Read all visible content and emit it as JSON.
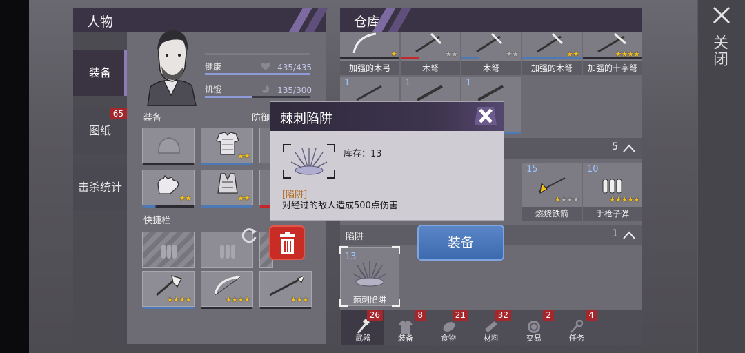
{
  "close": {
    "label": "关闭"
  },
  "character": {
    "title": "人物",
    "tabs": [
      {
        "label": "装备",
        "active": true,
        "badge": ""
      },
      {
        "label": "图纸",
        "active": false,
        "badge": "65"
      },
      {
        "label": "击杀统计",
        "active": false,
        "badge": ""
      }
    ],
    "stats": [
      {
        "label": "健康",
        "icon": "heart-icon",
        "value": "435/435",
        "fill": 1.0
      },
      {
        "label": "饥饿",
        "icon": "stomach-icon",
        "value": "135/300",
        "fill": 0.45
      }
    ],
    "equip_label": "装备",
    "defense_label": "防御",
    "quickbar_label": "快捷栏",
    "equip_slots": [
      {
        "name": "helmet-slot",
        "stars": 0,
        "stars_max": 0
      },
      {
        "name": "body-armor-slot",
        "stars": 2,
        "stars_max": 2
      },
      {
        "name": "gloves-slot",
        "stars": 2,
        "stars_max": 2
      },
      {
        "name": "vest-slot",
        "stars": 2,
        "stars_max": 2
      }
    ],
    "quick_slots": [
      {
        "name": "ammo-slot-1",
        "stars": 0
      },
      {
        "name": "ammo-slot-2",
        "stars": 0
      },
      {
        "name": "axe-slot",
        "stars": 4
      },
      {
        "name": "bow-slot",
        "stars": 4
      },
      {
        "name": "spear-slot",
        "stars": 3
      }
    ]
  },
  "warehouse": {
    "title": "仓库",
    "weapons": [
      {
        "label": "加强的木弓",
        "stars": 1,
        "stars_max": 1
      },
      {
        "label": "木弩",
        "stars": 0,
        "stars_max": 2
      },
      {
        "label": "木弩",
        "stars": 0,
        "stars_max": 2
      },
      {
        "label": "加强的木弩",
        "stars": 2,
        "stars_max": 2
      },
      {
        "label": "加强的十字弩",
        "stars": 4,
        "stars_max": 4
      }
    ],
    "row2_counts": [
      "1",
      "1",
      "1"
    ],
    "row2_count_partial": "5",
    "ammo": [
      {
        "label": "燃烧铁箭",
        "count": "15",
        "stars": 1,
        "stars_max": 4
      },
      {
        "label": "手枪子弹",
        "count": "10",
        "stars": 5,
        "stars_max": 5
      }
    ],
    "trap_category": {
      "label": "陷阱",
      "count": "1"
    },
    "trap_item": {
      "label": "棘刺陷阱",
      "count": "13"
    },
    "equip_button": "装备",
    "bottom_tabs": [
      {
        "label": "武器",
        "badge": "26",
        "icon": "hammer-icon",
        "active": true
      },
      {
        "label": "装备",
        "badge": "8",
        "icon": "shirt-icon",
        "active": false
      },
      {
        "label": "食物",
        "badge": "21",
        "icon": "meat-icon",
        "active": false
      },
      {
        "label": "材料",
        "badge": "32",
        "icon": "plank-icon",
        "active": false
      },
      {
        "label": "交易",
        "badge": "2",
        "icon": "coin-icon",
        "active": false
      },
      {
        "label": "任务",
        "badge": "4",
        "icon": "key-icon",
        "active": false
      }
    ]
  },
  "popup": {
    "title": "棘刺陷阱",
    "stock": "库存：13",
    "tag": "[陷阱]",
    "description": "对经过的敌人造成500点伤害"
  },
  "colors": {
    "accent_purple": "#7d6aa0",
    "star_gold": "#f4c01a",
    "badge_red": "#a5262b",
    "equip_blue": "#3d6aae",
    "trash_red": "#c92c24"
  }
}
